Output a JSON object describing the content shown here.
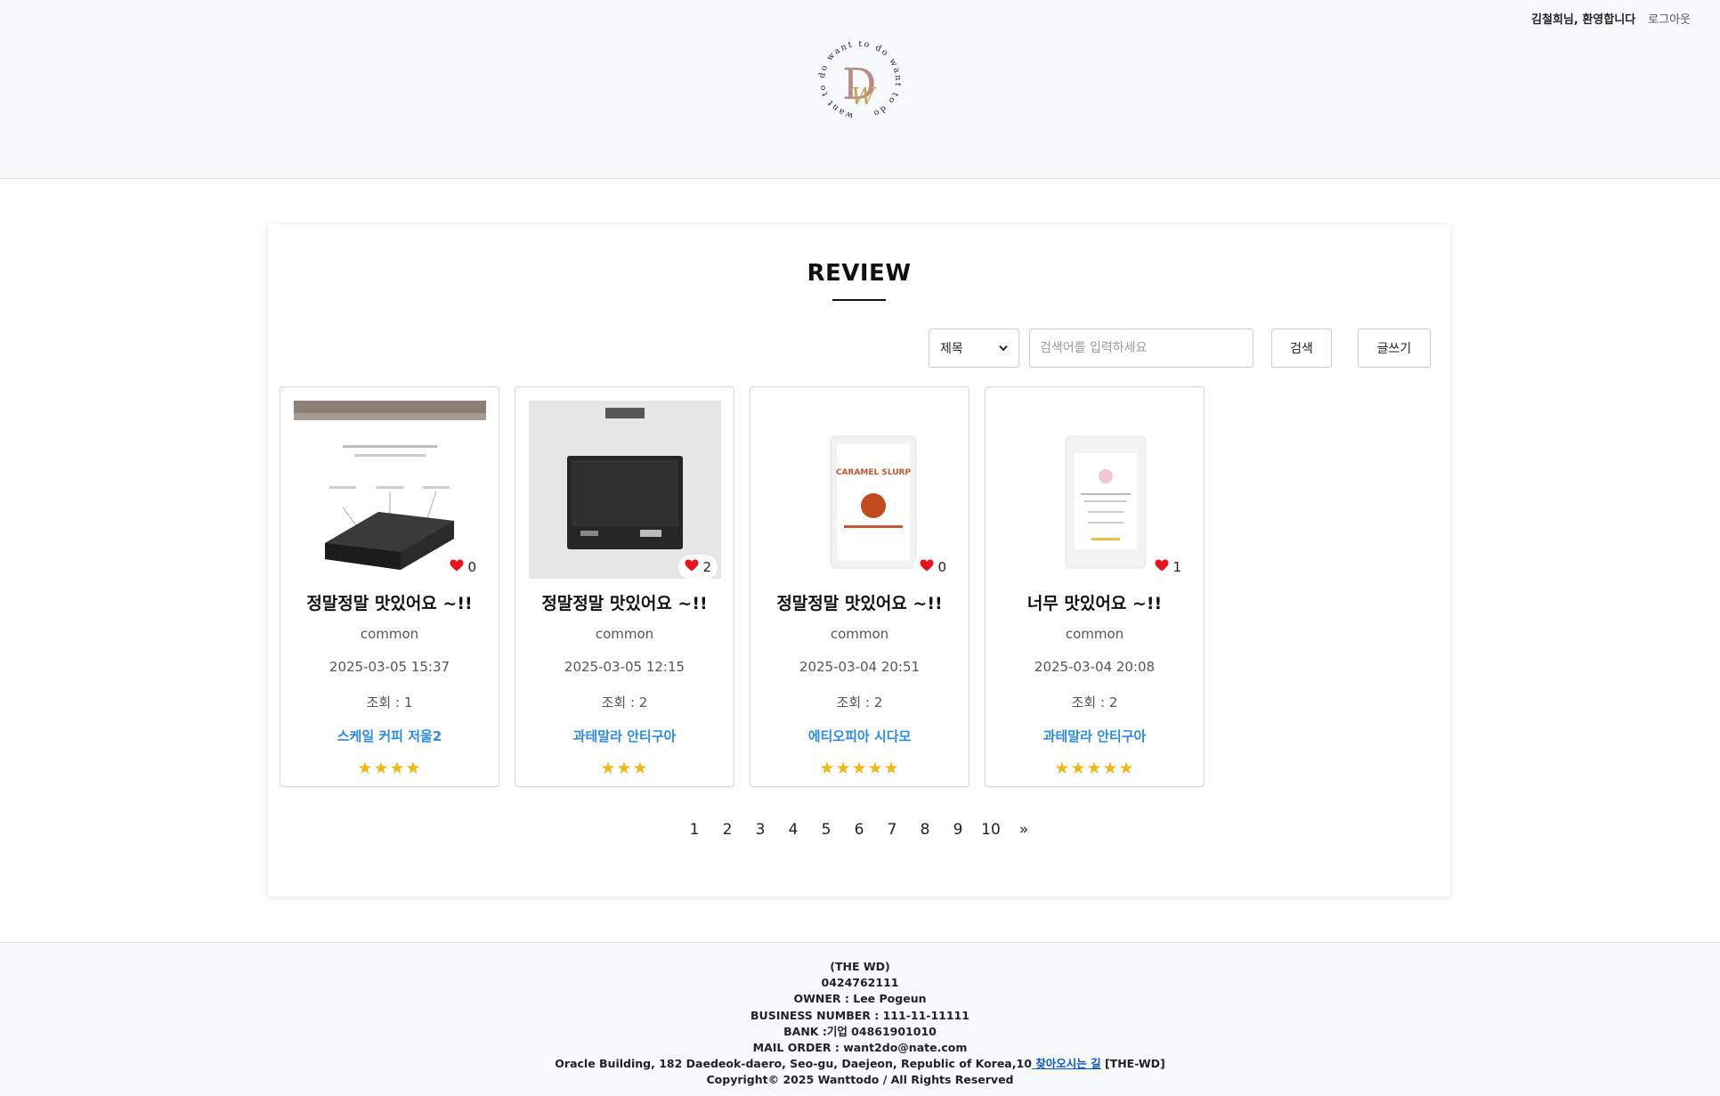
{
  "header": {
    "welcome": "김철희님, 환영합니다",
    "logout": "로그아웃",
    "logo_ring_text": "want to do want to do want to do",
    "logo_letters": "DW"
  },
  "main": {
    "title": "REVIEW",
    "search": {
      "select_value": "제목",
      "placeholder": "검색어를 입력하세요",
      "search_button": "검색",
      "write_button": "글쓰기"
    },
    "cards": [
      {
        "title": "정말정말 맛있어요 ~!!",
        "writer": "common",
        "date": "2025-03-05 15:37",
        "views": "조회 : 1",
        "product": "스케일 커피 저울2",
        "stars": "★★★★",
        "likes": "0",
        "thumb": "scale-photo"
      },
      {
        "title": "정말정말 맛있어요 ~!!",
        "writer": "common",
        "date": "2025-03-05 12:15",
        "views": "조회 : 2",
        "product": "과테말라 안티구아",
        "stars": "★★★",
        "likes": "2",
        "thumb": "scale-box"
      },
      {
        "title": "정말정말 맛있어요 ~!!",
        "writer": "common",
        "date": "2025-03-04 20:51",
        "views": "조회 : 2",
        "product": "에티오피아 시다모",
        "stars": "★★★★★",
        "likes": "0",
        "thumb": "caramel-bag"
      },
      {
        "title": "너무 맛있어요 ~!!",
        "writer": "common",
        "date": "2025-03-04 20:08",
        "views": "조회 : 2",
        "product": "과테말라 안티구아",
        "stars": "★★★★★",
        "likes": "1",
        "thumb": "white-bag"
      }
    ],
    "thumb_text": {
      "caramel_bag_label": "CARAMEL SLURP"
    },
    "pagination": [
      "1",
      "2",
      "3",
      "4",
      "5",
      "6",
      "7",
      "8",
      "9",
      "10",
      "»"
    ]
  },
  "footer": {
    "company": "(THE WD)",
    "phone": "0424762111",
    "owner": "OWNER : Lee Pogeun",
    "business": "BUSINESS NUMBER : 111-11-11111",
    "bank": "BANK :기업 04861901010",
    "mail": "MAIL ORDER : want2do@nate.com",
    "address": "Oracle Building, 182 Daedeok-daero, Seo-gu, Daejeon, Republic of Korea,10",
    "directions_link": " 찾아오시는 길",
    "address_suffix": " [THE-WD]",
    "copyright": "Copyright© 2025 Wanttodo / All Rights Reserved"
  },
  "colors": {
    "accent_link": "#2b8be6",
    "star": "#f0b815",
    "heart": "#e8141b",
    "logo_brown": "#b98a8a",
    "logo_gold": "#c9a34a"
  }
}
